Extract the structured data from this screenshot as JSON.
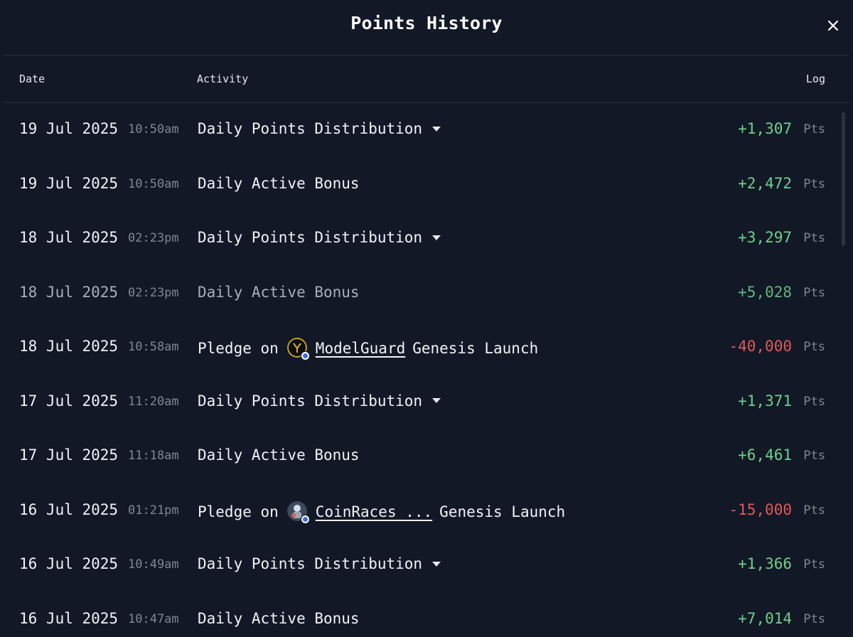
{
  "modal": {
    "title": "Points History",
    "close_label": "×"
  },
  "columns": {
    "date": "Date",
    "activity": "Activity",
    "log": "Log"
  },
  "unit": "Pts",
  "colors": {
    "positive": "#6fd08c",
    "negative": "#e05a5a",
    "background": "#121826"
  },
  "rows": [
    {
      "date": "19 Jul 2025",
      "time": "10:50am",
      "activity": "Daily Points Distribution",
      "expandable": true,
      "amount": "+1,307",
      "sign": "positive"
    },
    {
      "date": "19 Jul 2025",
      "time": "10:50am",
      "activity": "Daily Active Bonus",
      "expandable": false,
      "amount": "+2,472",
      "sign": "positive"
    },
    {
      "date": "18 Jul 2025",
      "time": "02:23pm",
      "activity": "Daily Points Distribution",
      "expandable": true,
      "amount": "+3,297",
      "sign": "positive"
    },
    {
      "date": "18 Jul 2025",
      "time": "02:23pm",
      "activity": "Daily Active Bonus",
      "expandable": false,
      "amount": "+5,028",
      "sign": "positive"
    },
    {
      "date": "18 Jul 2025",
      "time": "10:58am",
      "activity_prefix": "Pledge on",
      "token": "ModelGuard",
      "token_icon": "modelguard-avatar-icon",
      "activity_suffix": "Genesis Launch",
      "amount": "-40,000",
      "sign": "negative"
    },
    {
      "date": "17 Jul 2025",
      "time": "11:20am",
      "activity": "Daily Points Distribution",
      "expandable": true,
      "amount": "+1,371",
      "sign": "positive"
    },
    {
      "date": "17 Jul 2025",
      "time": "11:18am",
      "activity": "Daily Active Bonus",
      "expandable": false,
      "amount": "+6,461",
      "sign": "positive"
    },
    {
      "date": "16 Jul 2025",
      "time": "01:21pm",
      "activity_prefix": "Pledge on",
      "token": "CoinRaces ...",
      "token_icon": "coinraces-avatar-icon",
      "activity_suffix": "Genesis Launch",
      "amount": "-15,000",
      "sign": "negative"
    },
    {
      "date": "16 Jul 2025",
      "time": "10:49am",
      "activity": "Daily Points Distribution",
      "expandable": true,
      "amount": "+1,366",
      "sign": "positive"
    },
    {
      "date": "16 Jul 2025",
      "time": "10:47am",
      "activity": "Daily Active Bonus",
      "expandable": false,
      "amount": "+7,014",
      "sign": "positive"
    }
  ]
}
